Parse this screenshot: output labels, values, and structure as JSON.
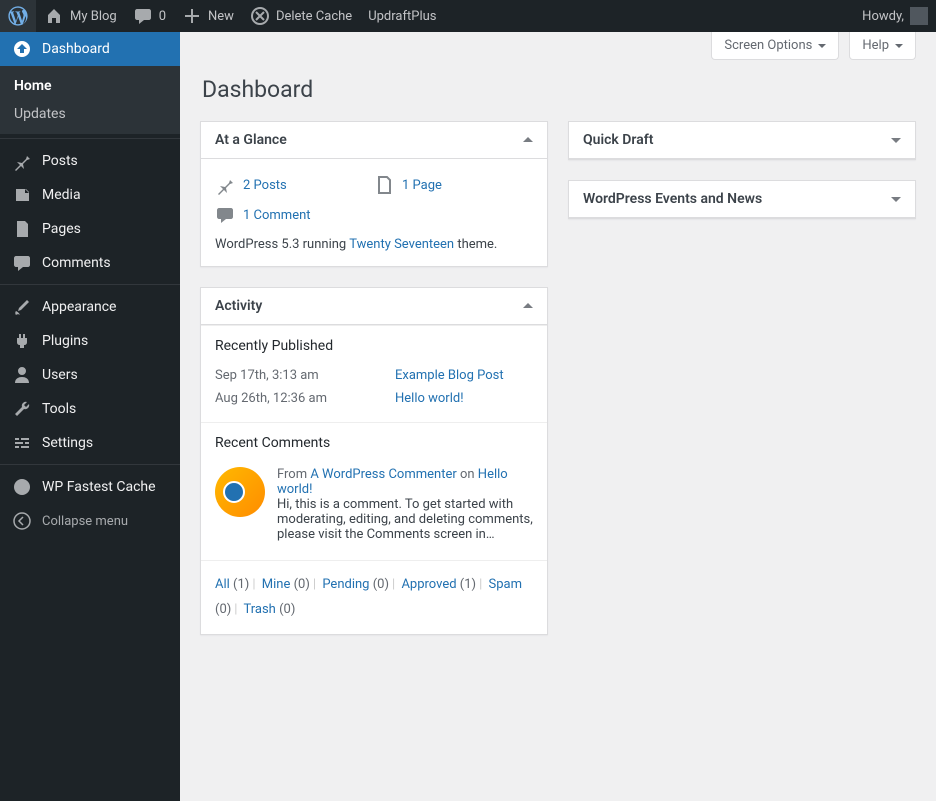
{
  "adminbar": {
    "site_title": "My Blog",
    "comments_count": "0",
    "new_label": "New",
    "delete_cache": "Delete Cache",
    "updraft": "UpdraftPlus",
    "howdy": "Howdy,"
  },
  "sidebar": {
    "dashboard": "Dashboard",
    "home": "Home",
    "updates": "Updates",
    "posts": "Posts",
    "media": "Media",
    "pages": "Pages",
    "comments": "Comments",
    "appearance": "Appearance",
    "plugins": "Plugins",
    "users": "Users",
    "tools": "Tools",
    "settings": "Settings",
    "wpfc": "WP Fastest Cache",
    "collapse": "Collapse menu"
  },
  "screen_meta": {
    "screen_options": "Screen Options",
    "help": "Help"
  },
  "heading": "Dashboard",
  "glance": {
    "title": "At a Glance",
    "posts": "2 Posts",
    "pages": "1 Page",
    "comments": "1 Comment",
    "version_prefix": "WordPress 5.3 running ",
    "theme": "Twenty Seventeen",
    "version_suffix": " theme."
  },
  "activity": {
    "title": "Activity",
    "published_heading": "Recently Published",
    "pub": [
      {
        "date": "Sep 17th, 3:13 am",
        "title": "Example Blog Post"
      },
      {
        "date": "Aug 26th, 12:36 am",
        "title": "Hello world!"
      }
    ],
    "comments_heading": "Recent Comments",
    "comment_from": "From ",
    "comment_author": "A WordPress Commenter",
    "comment_on": " on ",
    "comment_post": "Hello world!",
    "comment_excerpt": "Hi, this is a comment. To get started with moderating, editing, and deleting comments, please visit the Comments screen in…",
    "filters": [
      {
        "label": "All",
        "count": "(1)"
      },
      {
        "label": "Mine",
        "count": "(0)"
      },
      {
        "label": "Pending",
        "count": "(0)"
      },
      {
        "label": "Approved",
        "count": "(1)"
      },
      {
        "label": "Spam",
        "count": "(0)"
      },
      {
        "label": "Trash",
        "count": "(0)"
      }
    ]
  },
  "quickdraft": {
    "title": "Quick Draft"
  },
  "events": {
    "title": "WordPress Events and News"
  }
}
